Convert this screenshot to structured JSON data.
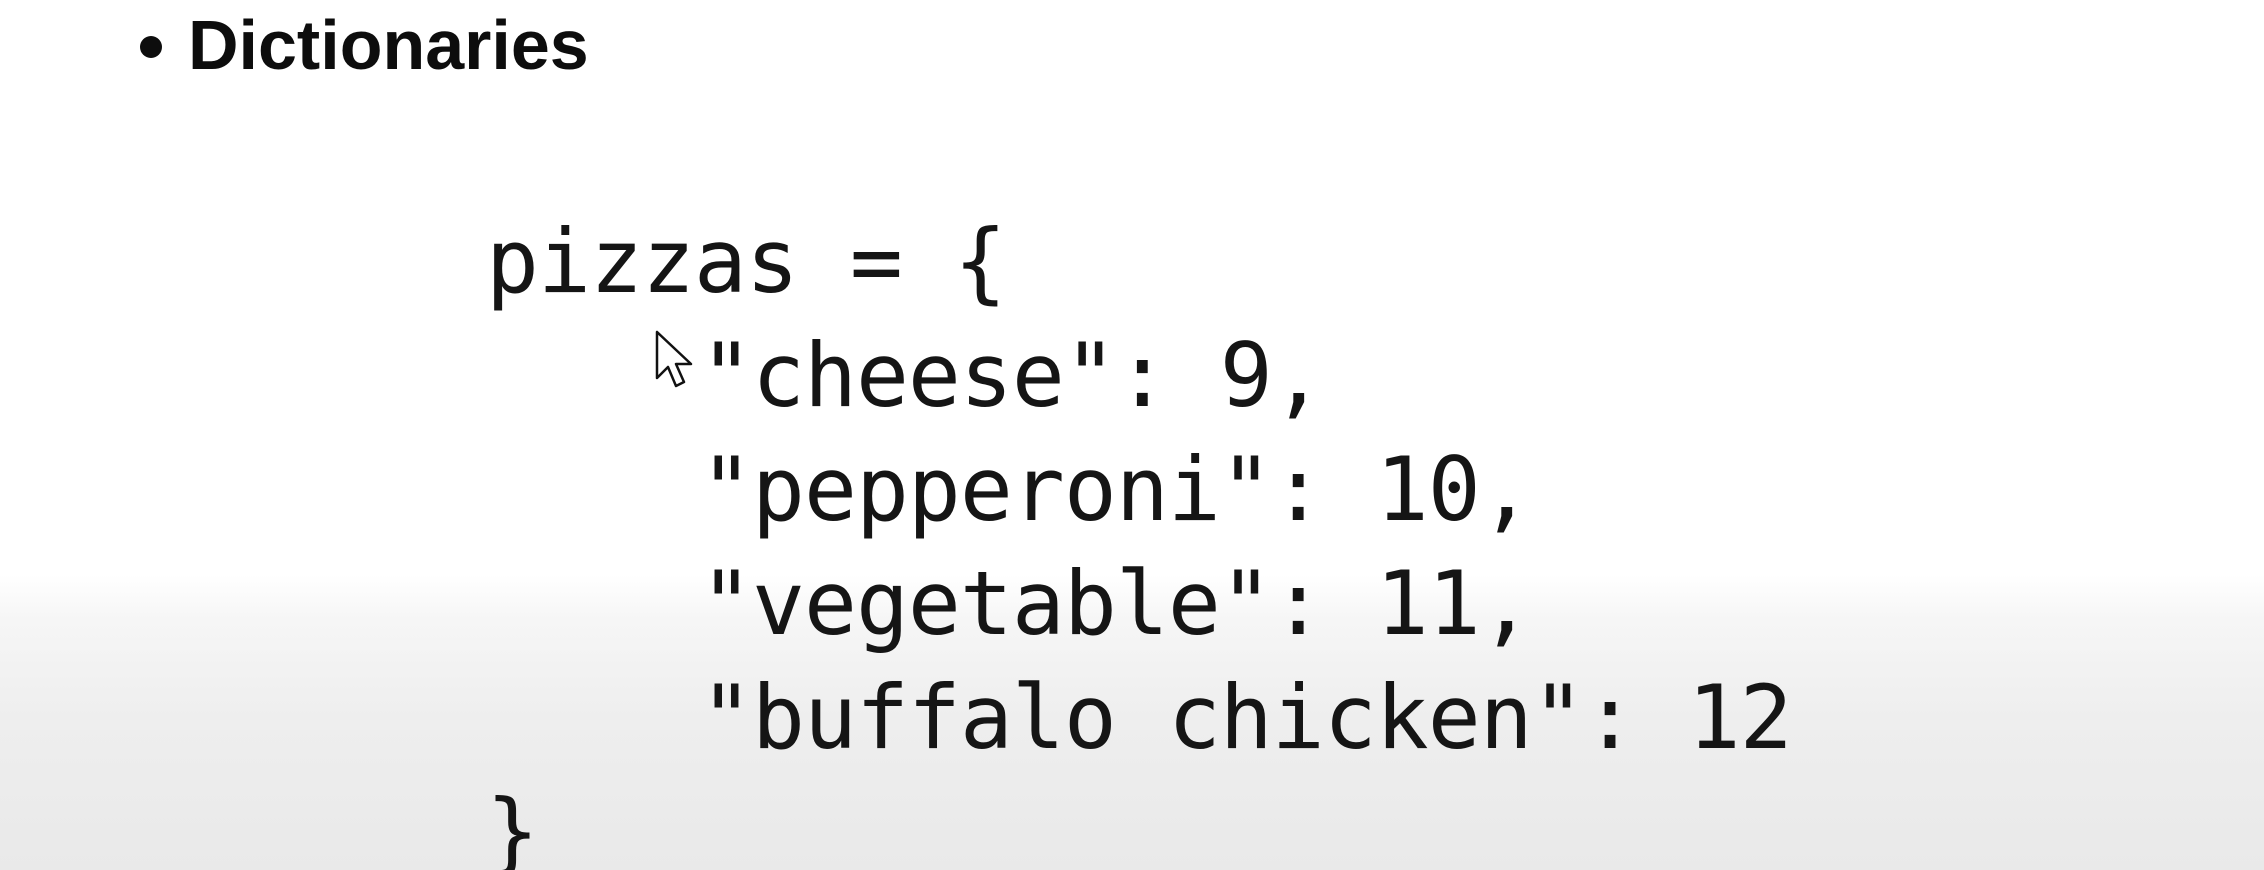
{
  "slide": {
    "bullet_heading": "Dictionaries",
    "code_lines": [
      "pizzas = {",
      "\"cheese\": 9,",
      "\"pepperoni\": 10,",
      "\"vegetable\": 11,",
      "\"buffalo chicken\": 12",
      "}"
    ]
  },
  "icons": {
    "cursor": "mouse-pointer-icon"
  },
  "colors": {
    "text": "#151515",
    "background_top": "#ffffff",
    "background_bottom": "#e9e9e9"
  }
}
